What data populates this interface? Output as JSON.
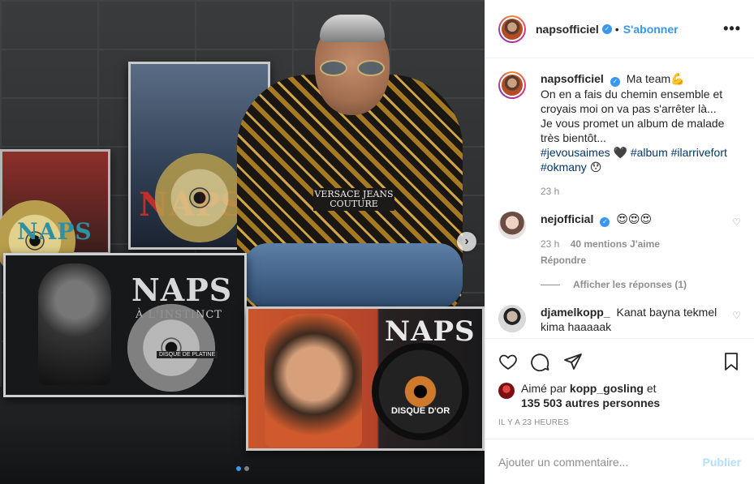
{
  "post": {
    "username": "napsofficiel",
    "follow_sep": "•",
    "follow_label": "S'abonner",
    "more_label": "•••"
  },
  "caption": {
    "username": "napsofficiel",
    "line1": "Ma team💪",
    "line2": "On en a fais du chemin ensemble et croyais moi on va pas s'arrêter là...",
    "line3": "Je vous promet un album de malade très bientôt...",
    "hashtags": [
      "#jevousaimes",
      "🖤",
      "#album",
      "#ilarrivefort",
      "#okmany",
      "😯"
    ],
    "time": "23 h"
  },
  "comments": [
    {
      "username": "nejofficial",
      "text": "😍😍😍",
      "time": "23 h",
      "likes": "40 mentions J'aime",
      "reply": "Répondre",
      "view_replies": "Afficher les réponses (1)"
    },
    {
      "username": "djamelkopp_",
      "text": "Kanat bayna tekmel kima haaaaak"
    }
  ],
  "liked_by": {
    "prefix": "Aimé par",
    "user": "kopp_gosling",
    "suffix": "et",
    "others": "135 503 autres personnes"
  },
  "timestamp": "IL Y A 23 HEURES",
  "add_comment": {
    "placeholder": "Ajouter un commentaire...",
    "publish": "Publier"
  },
  "media": {
    "brand_a": "NAPS",
    "brand_b": "NAPS",
    "brand_c": "NAPS",
    "subtitle_c": "À L'INSTINCT",
    "plaque_c": "DISQUE DE PLATINE",
    "brand_d": "NAPS",
    "plaque_d": "DISQUE D'OR",
    "shirt_text": "VERSACE JEANS COUTURE",
    "next_icon": "chevron-right-icon",
    "carousel_index": 1,
    "carousel_total": 2
  },
  "colors": {
    "accent": "#3897f0",
    "publish_disabled": "#b2dffc",
    "secondary": "#8e8e8e"
  }
}
